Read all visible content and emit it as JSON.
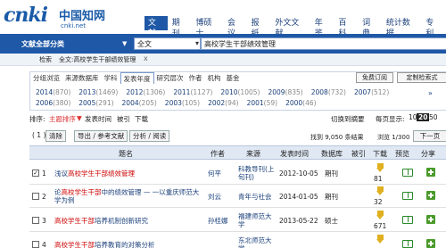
{
  "logo": {
    "brand": "cnki",
    "chinese": "中国知网",
    "url": "cnki.net"
  },
  "nav": {
    "tabs": [
      "文献",
      "期刊",
      "博硕士",
      "会议",
      "报纸",
      "外文文献",
      "年鉴",
      "百科",
      "词典",
      "统计数据",
      "专利"
    ],
    "active_index": 0
  },
  "search": {
    "category_label": "文献全部分类",
    "category_arrow": "▼",
    "field_select": "全文",
    "query": "高校学生干部绩效管理"
  },
  "breadcrumb": {
    "label": "检索",
    "path": "全文:高校学生干部绩效管理",
    "close": "x"
  },
  "facets": {
    "group_tabs": [
      "分组浏览",
      "来源数据库",
      "学科",
      "发表年度",
      "研究层次",
      "作者",
      "机构",
      "基金"
    ],
    "selected_index": 3,
    "subscribe_btn": "免费订阅",
    "custom_btn": "定制检索式",
    "years_row1": [
      {
        "year": "2014",
        "count": "(870)"
      },
      {
        "year": "2013",
        "count": "(1469)"
      },
      {
        "year": "2012",
        "count": "(1306)"
      },
      {
        "year": "2011",
        "count": "(1127)"
      },
      {
        "year": "2010",
        "count": "(1005)"
      },
      {
        "year": "2009",
        "count": "(835)"
      },
      {
        "year": "2008",
        "count": "(732)"
      },
      {
        "year": "2007",
        "count": "(512)"
      }
    ],
    "years_row2": [
      {
        "year": "2006",
        "count": "(380)"
      },
      {
        "year": "2005",
        "count": "(291)"
      },
      {
        "year": "2004",
        "count": "(205)"
      },
      {
        "year": "2003",
        "count": "(105)"
      },
      {
        "year": "2002",
        "count": "(94)"
      },
      {
        "year": "2001",
        "count": "(59)"
      },
      {
        "year": "2000",
        "count": "(46)"
      }
    ],
    "more": "»"
  },
  "sort": {
    "label": "排序:",
    "options": [
      "主题排序",
      "发表时间",
      "被引",
      "下载"
    ],
    "active_marker": "▼",
    "view_label": "切换到摘要",
    "per_page_label": "每页显示:",
    "per_page_options": [
      "10",
      "20",
      "50"
    ],
    "per_page_selected": "20"
  },
  "actions": {
    "selected_count": "( 1 )",
    "clear": "清除",
    "export": "导出 / 参考文献",
    "analyze": "分析 / 阅读",
    "found": "找到 9,050 条结果",
    "page_info": "浏览 1/300",
    "next": "下一页"
  },
  "table": {
    "headers": [
      "题名",
      "作者",
      "来源",
      "发表时间",
      "数据库",
      "被引",
      "下载",
      "预览",
      "分享"
    ],
    "rows": [
      {
        "no": "1",
        "checked": true,
        "title_pre": "浅议",
        "title_hl": "高校学生干部绩效管理",
        "title_post": "",
        "author": "何平",
        "source": "科教导刊(上旬刊)",
        "date": "2012-10-05",
        "db": "期刊",
        "cited": "",
        "downloads": "81"
      },
      {
        "no": "2",
        "checked": false,
        "title_pre": "论",
        "title_hl": "高校学生干部",
        "title_post": "中的绩效管理 — 一以重庆师范大学为例",
        "author": "刘云",
        "source": "青年与社会",
        "date": "2014-01-05",
        "db": "期刊",
        "cited": "",
        "downloads": "32"
      },
      {
        "no": "3",
        "checked": false,
        "title_pre": "",
        "title_hl": "高校学生干部",
        "title_post": "培养机制创新研究",
        "author": "孙桂娜",
        "source": "福建师范大学",
        "date": "2013-05-22",
        "db": "硕士",
        "cited": "",
        "downloads": "671"
      },
      {
        "no": "4",
        "checked": false,
        "title_pre": "",
        "title_hl": "高校学生干部",
        "title_post": "培养教育的对策分析",
        "author": "",
        "source": "东北师范大学",
        "date": "",
        "db": "",
        "cited": "",
        "downloads": ""
      }
    ]
  }
}
